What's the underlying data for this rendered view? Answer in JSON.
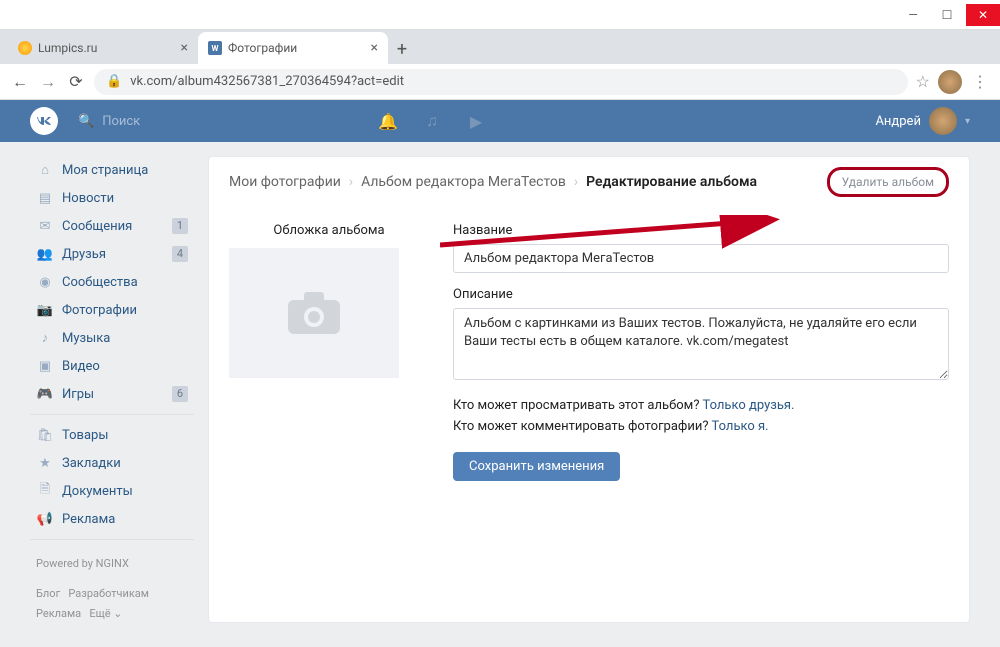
{
  "window": {
    "tabs": [
      {
        "title": "Lumpics.ru",
        "active": false
      },
      {
        "title": "Фотографии",
        "active": true
      }
    ],
    "url": "vk.com/album432567381_270364594?act=edit"
  },
  "vk": {
    "search_placeholder": "Поиск",
    "username": "Андрей",
    "sidebar": [
      {
        "icon": "home",
        "label": "Моя страница",
        "badge": ""
      },
      {
        "icon": "feed",
        "label": "Новости",
        "badge": ""
      },
      {
        "icon": "msg",
        "label": "Сообщения",
        "badge": "1"
      },
      {
        "icon": "friends",
        "label": "Друзья",
        "badge": "4"
      },
      {
        "icon": "groups",
        "label": "Сообщества",
        "badge": ""
      },
      {
        "icon": "photos",
        "label": "Фотографии",
        "badge": ""
      },
      {
        "icon": "music",
        "label": "Музыка",
        "badge": ""
      },
      {
        "icon": "video",
        "label": "Видео",
        "badge": ""
      },
      {
        "icon": "games",
        "label": "Игры",
        "badge": "6"
      }
    ],
    "sidebar2": [
      {
        "icon": "market",
        "label": "Товары"
      },
      {
        "icon": "bookmarks",
        "label": "Закладки"
      },
      {
        "icon": "docs",
        "label": "Документы"
      },
      {
        "icon": "ads",
        "label": "Реклама"
      }
    ],
    "footer": {
      "powered": "Powered by NGINX",
      "links": [
        "Блог",
        "Разработчикам",
        "Реклама",
        "Ещё ⌄"
      ]
    },
    "breadcrumb": {
      "root": "Мои фотографии",
      "album": "Альбом редактора МегаТестов",
      "current": "Редактирование альбома",
      "delete": "Удалить альбом"
    },
    "form": {
      "cover_label": "Обложка альбома",
      "title_label": "Название",
      "title_value": "Альбом редактора МегаТестов",
      "desc_label": "Описание",
      "desc_value": "Альбом с картинками из Ваших тестов. Пожалуйста, не удаляйте его если Ваши тесты есть в общем каталоге. vk.com/megatest",
      "perm_view_q": "Кто может просматривать этот альбом?",
      "perm_view_a": "Только друзья.",
      "perm_comment_q": "Кто может комментировать фотографии?",
      "perm_comment_a": "Только я.",
      "save": "Сохранить изменения"
    }
  }
}
